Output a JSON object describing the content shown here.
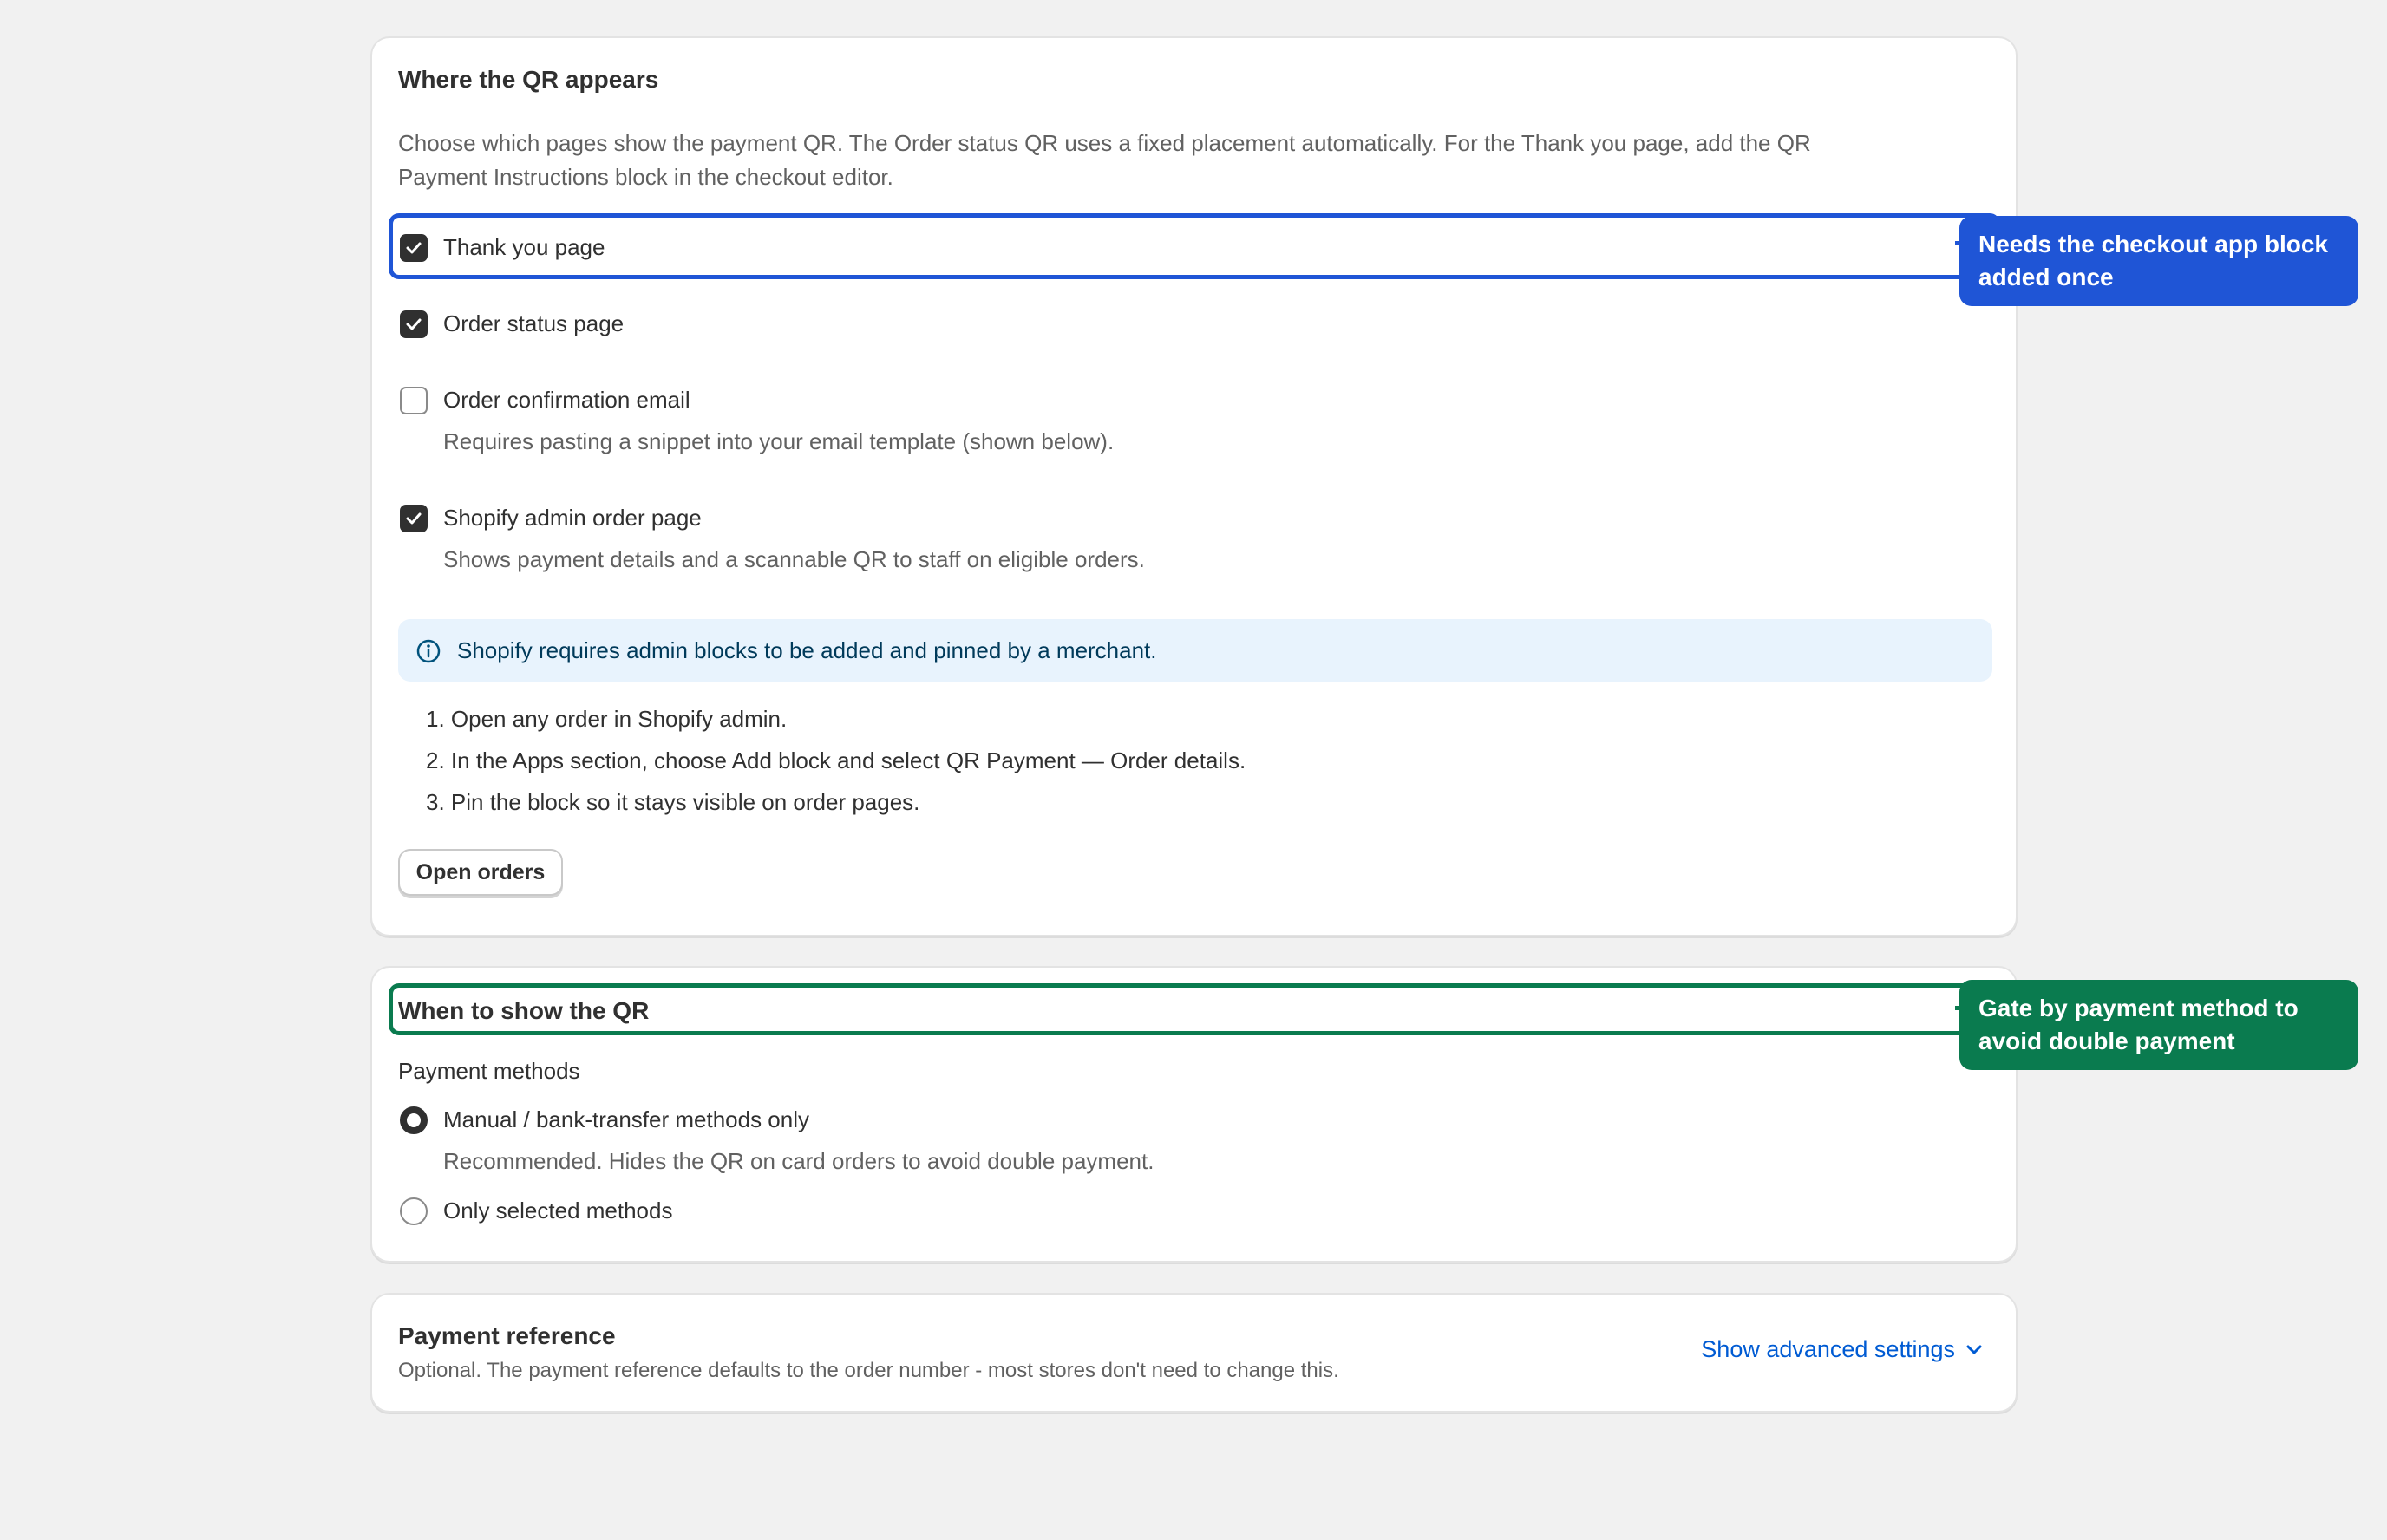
{
  "placement": {
    "title": "Where the QR appears",
    "description_line1": "Choose which pages show the payment QR. The Order status QR uses a fixed placement automatically. For the Thank you page, add the QR",
    "description_line2": "Payment Instructions block in the checkout editor.",
    "options": [
      {
        "label": "Thank you page",
        "checked": true,
        "help": ""
      },
      {
        "label": "Order status page",
        "checked": true,
        "help": ""
      },
      {
        "label": "Order confirmation email",
        "checked": false,
        "help": "Requires pasting a snippet into your email template (shown below)."
      },
      {
        "label": "Shopify admin order page",
        "checked": true,
        "help": "Shows payment details and a scannable QR to staff on eligible orders."
      }
    ],
    "banner_text": "Shopify requires admin blocks to be added and pinned by a merchant.",
    "steps": [
      "1. Open any order in Shopify admin.",
      "2. In the Apps section, choose Add block and select QR Payment — Order details.",
      "3. Pin the block so it stays visible on order pages."
    ],
    "open_orders_label": "Open orders"
  },
  "callouts": {
    "checkout_line1": "Needs the checkout app block",
    "checkout_line2": "added once",
    "gate_line1": "Gate by payment method to",
    "gate_line2": "avoid double payment",
    "blue": "#1f55d6",
    "green": "#0a7b4f"
  },
  "when": {
    "title": "When to show the QR",
    "group_label": "Payment methods",
    "options": [
      {
        "label": "Manual / bank-transfer methods only",
        "selected": true,
        "help": "Recommended. Hides the QR on card orders to avoid double payment."
      },
      {
        "label": "Only selected methods",
        "selected": false,
        "help": ""
      }
    ]
  },
  "reference": {
    "title": "Payment reference",
    "subtitle": "Optional. The payment reference defaults to the order number - most stores don't need to change this.",
    "advanced_label": "Show advanced settings"
  }
}
